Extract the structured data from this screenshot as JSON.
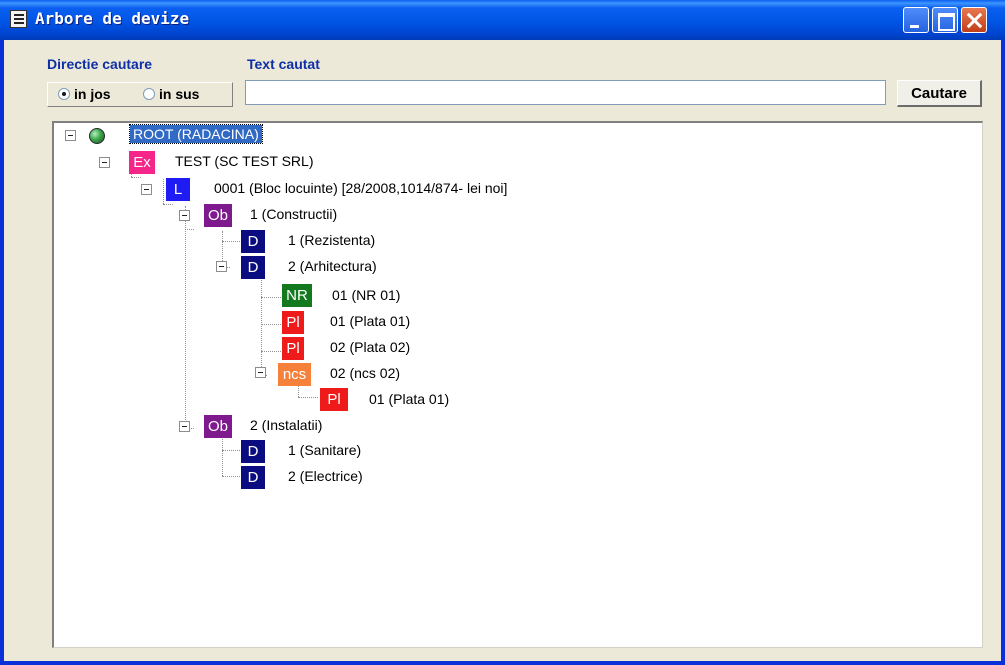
{
  "window": {
    "title": "Arbore de devize"
  },
  "search": {
    "direction_label": "Directie cautare",
    "text_label": "Text cautat",
    "options": [
      {
        "label": "in jos",
        "selected": true
      },
      {
        "label": "in sus",
        "selected": false
      }
    ],
    "query": "",
    "button_label": "Cautare"
  },
  "colors": {
    "Ex": "#f5258a",
    "L": "#1f1bf5",
    "Ob": "#7e1a8e",
    "D": "#0b0c80",
    "NR": "#12791f",
    "Pl": "#ef1b1b",
    "ncs": "#f6813a",
    "selection": "#316ac5"
  },
  "tree": {
    "root": {
      "icon": "globe-icon",
      "label": "ROOT (RADACINA)",
      "selected": true
    },
    "nodes": [
      {
        "icon": "Ex",
        "label": "TEST (SC TEST SRL)"
      },
      {
        "icon": "L",
        "label": "0001 (Bloc locuinte) [28/2008,1014/874- lei noi]"
      },
      {
        "icon": "Ob",
        "label": "1 (Constructii)"
      },
      {
        "icon": "D",
        "label": "1 (Rezistenta)"
      },
      {
        "icon": "D",
        "label": "2 (Arhitectura)"
      },
      {
        "icon": "NR",
        "label": "01 (NR 01)"
      },
      {
        "icon": "Pl",
        "label": "01 (Plata 01)"
      },
      {
        "icon": "Pl",
        "label": "02 (Plata 02)"
      },
      {
        "icon": "ncs",
        "label": "02 (ncs 02)"
      },
      {
        "icon": "Pl",
        "label": "01 (Plata 01)"
      },
      {
        "icon": "Ob",
        "label": "2 (Instalatii)"
      },
      {
        "icon": "D",
        "label": "1 (Sanitare)"
      },
      {
        "icon": "D",
        "label": "2 (Electrice)"
      }
    ]
  }
}
